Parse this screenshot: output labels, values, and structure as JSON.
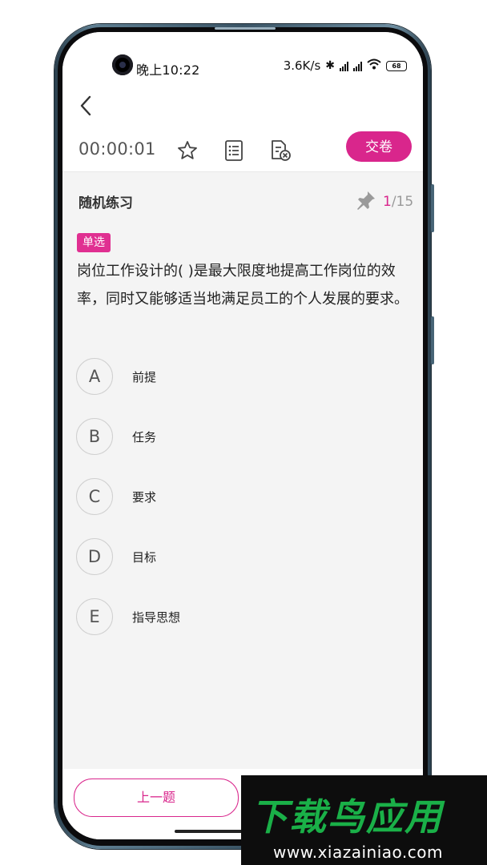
{
  "status_bar": {
    "time": "晚上10:22",
    "network_speed": "3.6K/s",
    "battery": "68"
  },
  "header": {
    "timer": "00:00:01",
    "submit_label": "交卷"
  },
  "quiz": {
    "section_title": "随机练习",
    "progress_current": "1",
    "progress_total": "/15",
    "question_type": "单选",
    "question_text": "岗位工作设计的( )是最大限度地提高工作岗位的效率，同时又能够适当地满足员工的个人发展的要求。",
    "options": [
      {
        "letter": "A",
        "text": "前提"
      },
      {
        "letter": "B",
        "text": "任务"
      },
      {
        "letter": "C",
        "text": "要求"
      },
      {
        "letter": "D",
        "text": "目标"
      },
      {
        "letter": "E",
        "text": "指导思想"
      }
    ]
  },
  "footer": {
    "prev_label": "上一题"
  },
  "watermark": {
    "title": "下载鸟应用",
    "url": "www.xiazainiao.com"
  },
  "colors": {
    "accent": "#d9268c",
    "background": "#f4f4f4"
  }
}
